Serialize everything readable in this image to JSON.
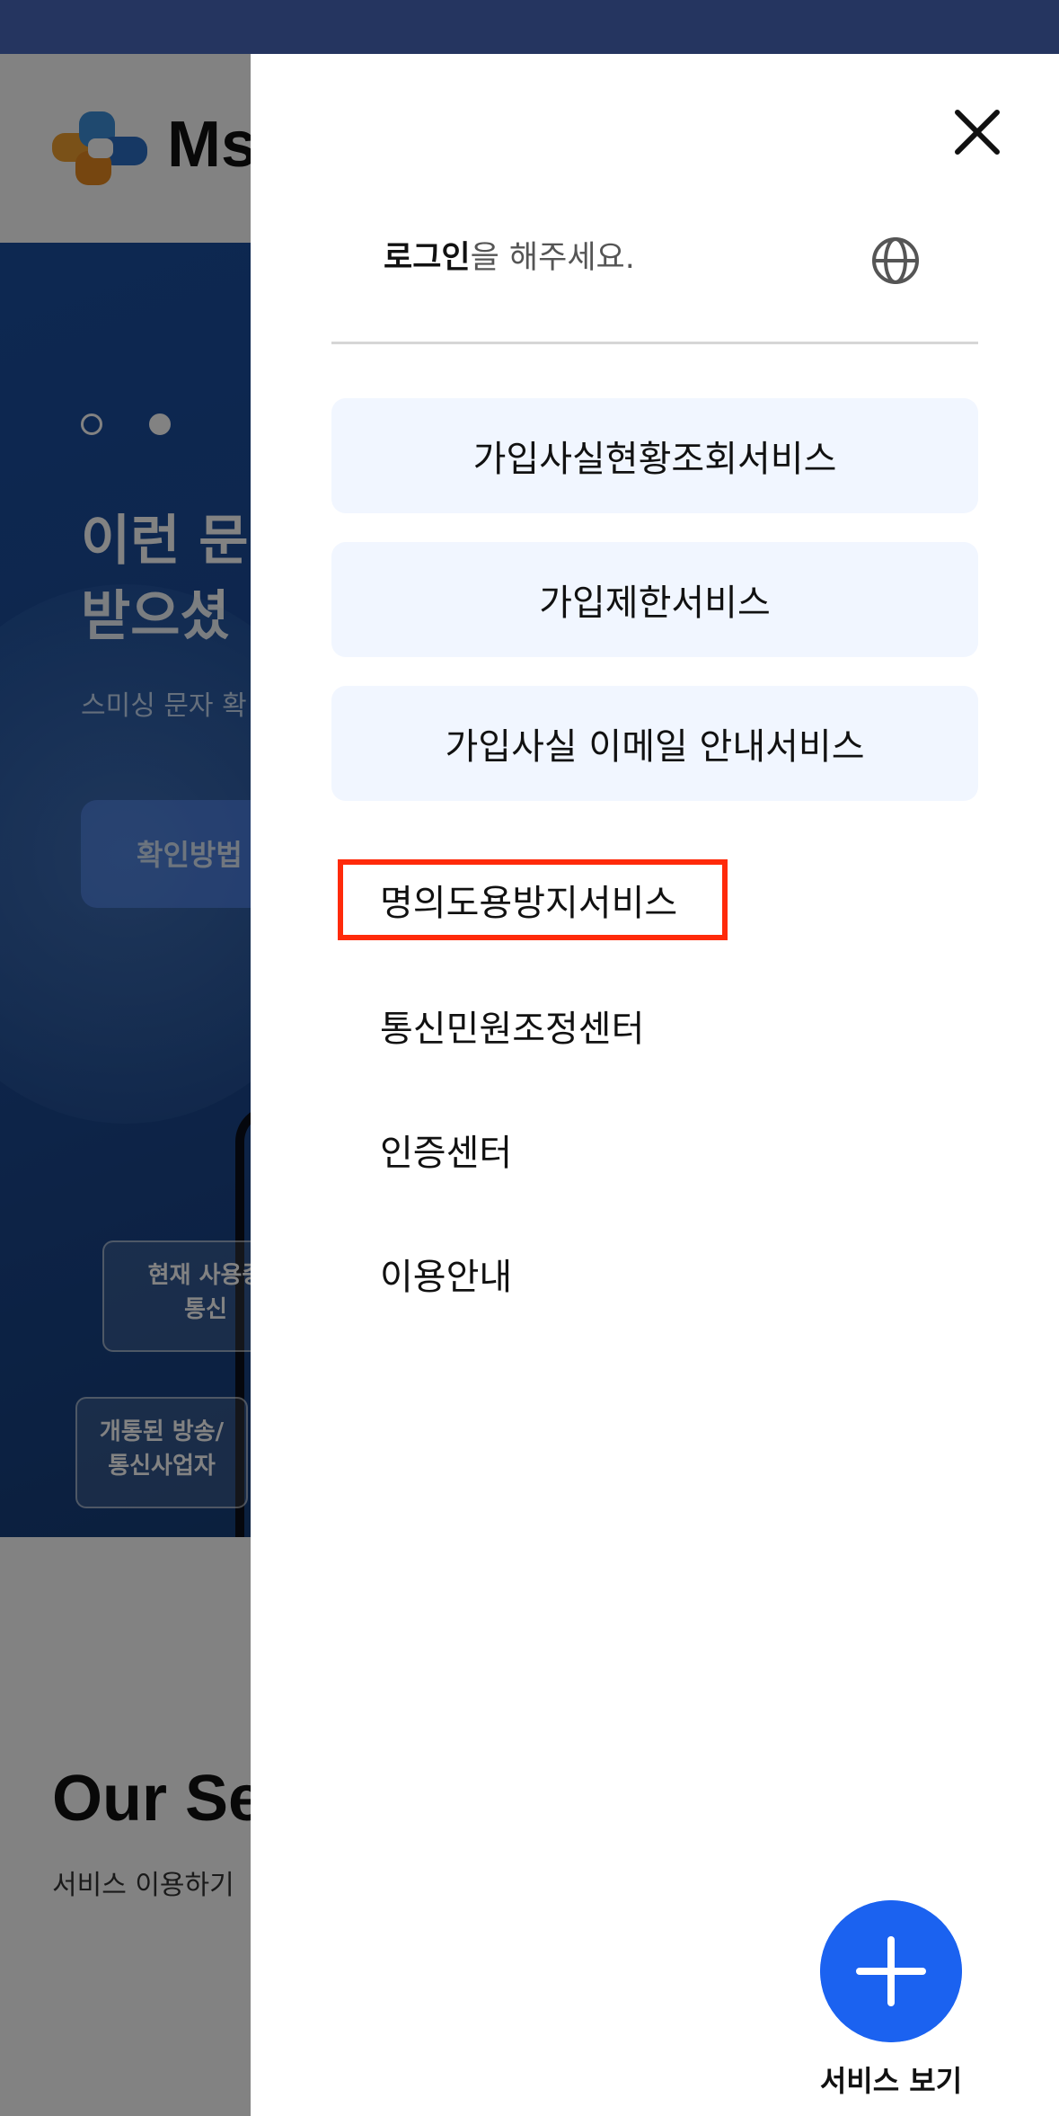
{
  "background": {
    "logo_text": "Ms",
    "hero": {
      "title": "이런 문\n받으셨",
      "subtitle": "스미싱 문자 확",
      "button_label": "확인방법",
      "chip_1": "현재 사용중\n통신",
      "chip_2": "개통된 방송/\n통신사업자"
    },
    "section": {
      "title": "Our Se",
      "subtitle": "서비스 이용하기"
    }
  },
  "drawer": {
    "login_bold": "로그인",
    "login_rest": "을 해주세요.",
    "cards": [
      {
        "label": "가입사실현황조회서비스"
      },
      {
        "label": "가입제한서비스"
      },
      {
        "label": "가입사실 이메일 안내서비스"
      }
    ],
    "menu": [
      {
        "label": "명의도용방지서비스"
      },
      {
        "label": "통신민원조정센터"
      },
      {
        "label": "인증센터"
      },
      {
        "label": "이용안내"
      }
    ],
    "fab_label": "서비스 보기"
  },
  "colors": {
    "status_bar": "#253560",
    "card_bg": "#f1f6ff",
    "highlight": "#ff2a0a",
    "fab": "#1b62f0"
  },
  "icons": [
    "close-icon",
    "globe-icon",
    "plus-icon",
    "logo-icon"
  ]
}
